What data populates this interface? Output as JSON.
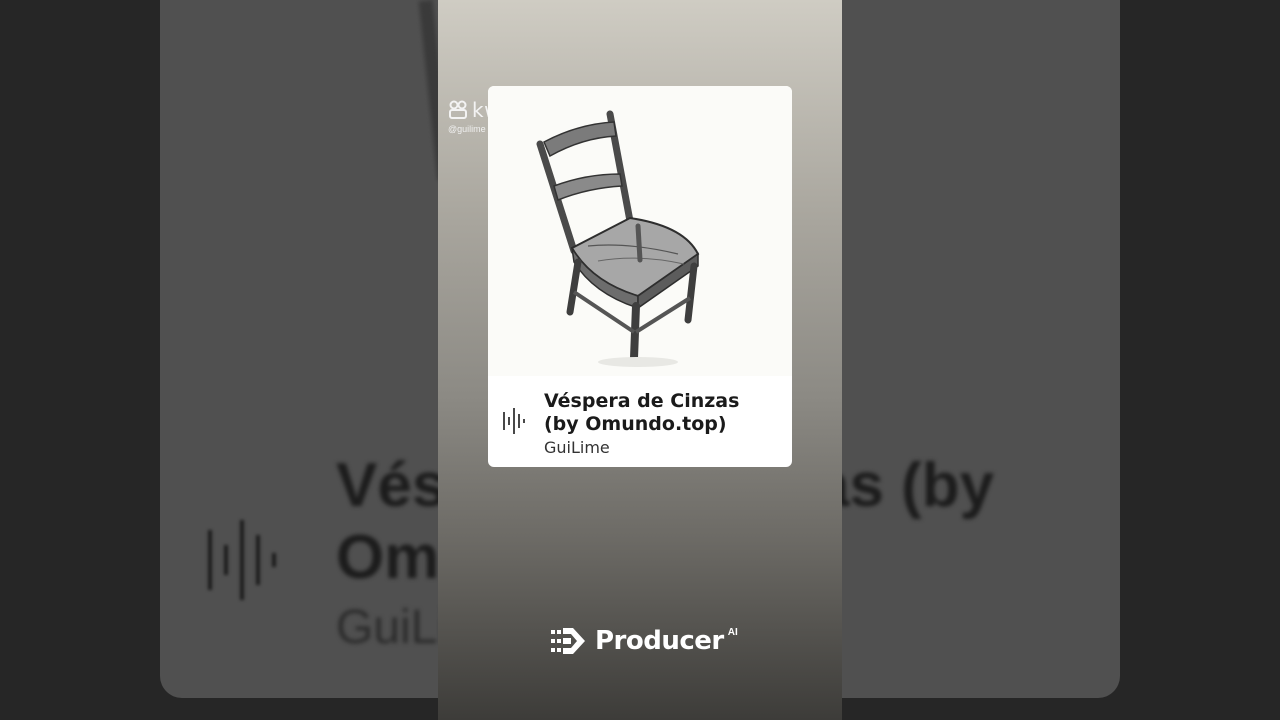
{
  "watermark": {
    "brand": "kwai",
    "handle": "@guilime"
  },
  "track": {
    "title": "Véspera de Cinzas (by Omundo.top)",
    "artist": "GuiLime",
    "artwork": "wooden-chair-sketch"
  },
  "background": {
    "title_fragment": "Véspera de Cinzas (by Omundo.top)",
    "artist_fragment": "GuiLime"
  },
  "footer": {
    "brand": "Producer",
    "superscript": "AI"
  },
  "colors": {
    "card_bg": "#ffffff",
    "strip_top": "#cfccc3",
    "strip_bottom": "#3d3c39"
  }
}
